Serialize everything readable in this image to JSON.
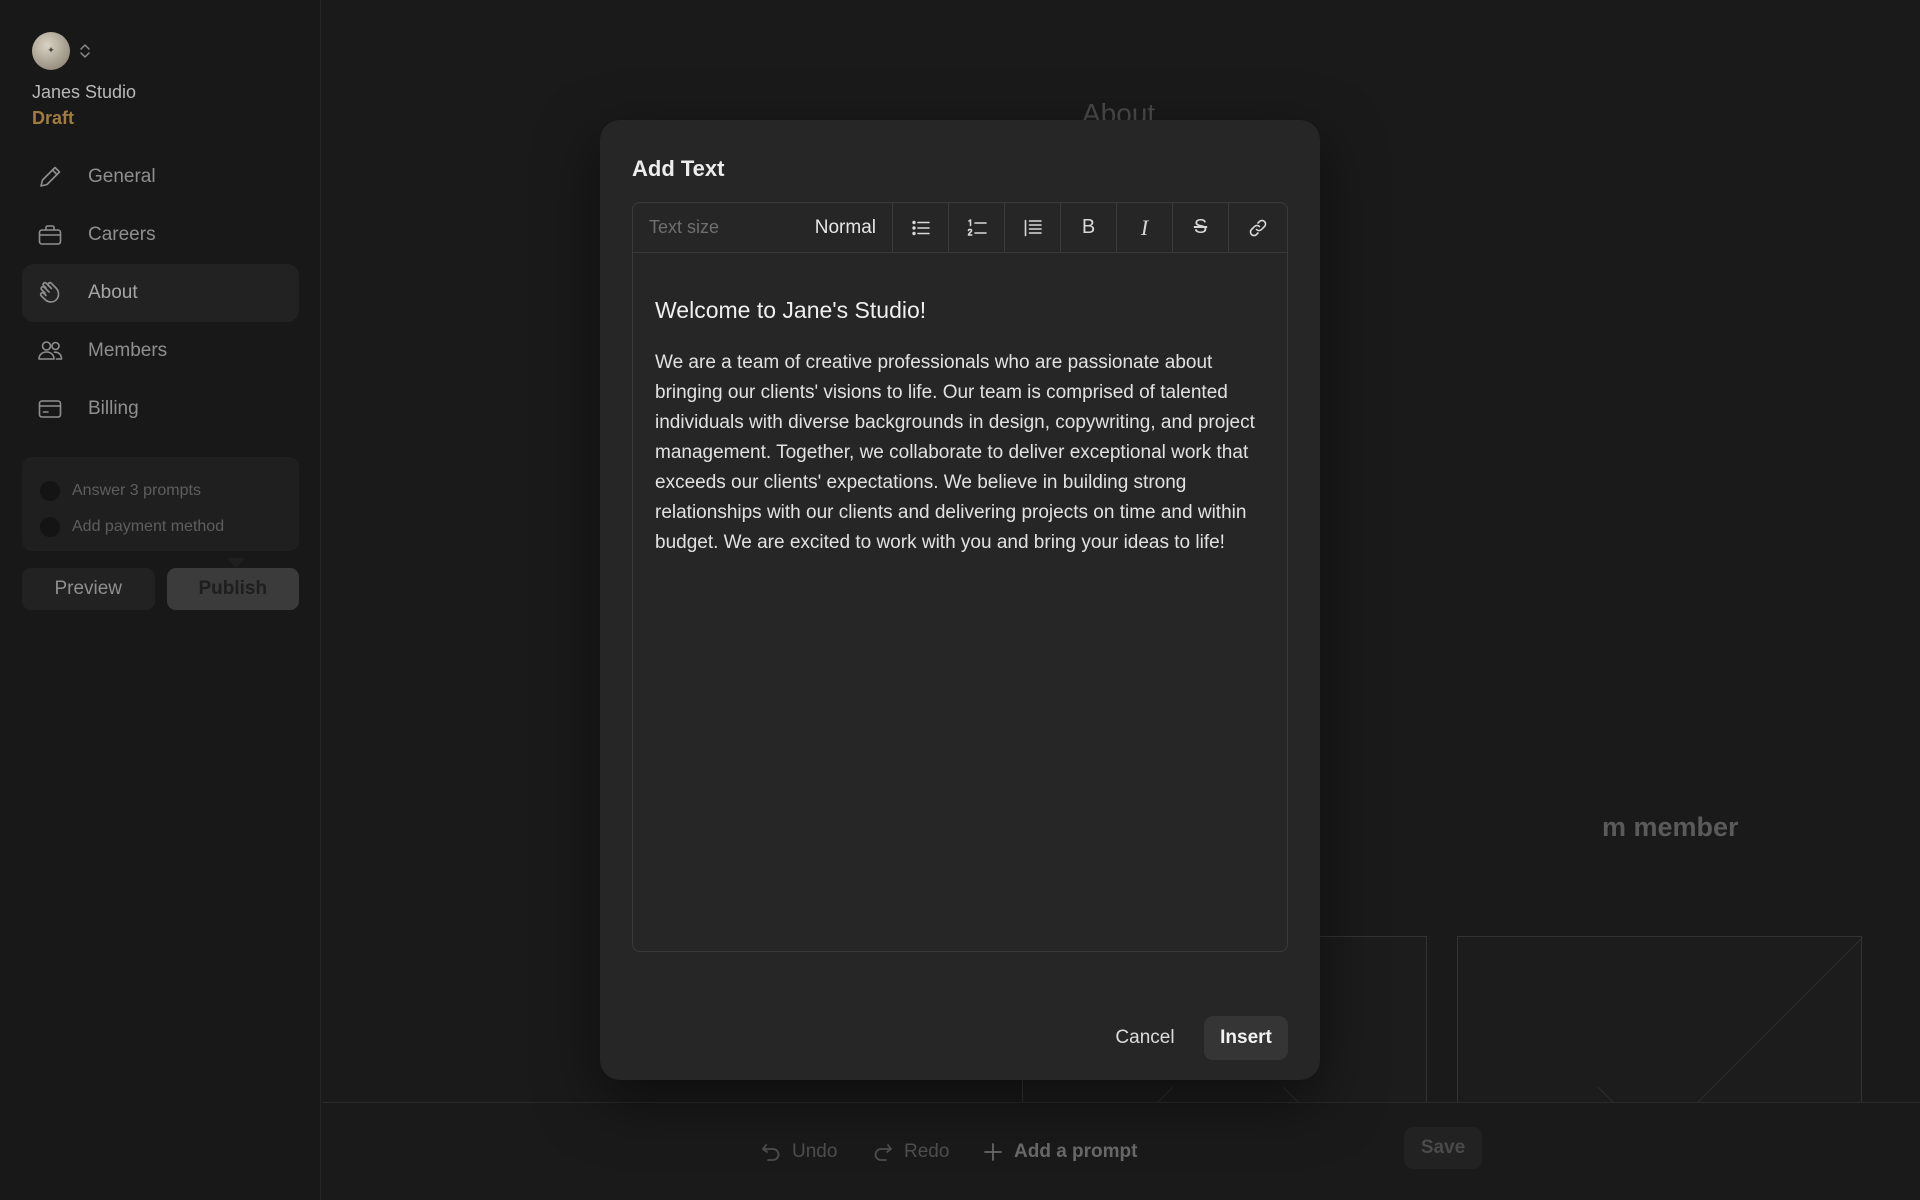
{
  "sidebar": {
    "workspace_name": "Janes Studio",
    "workspace_status": "Draft",
    "status_color": "#a27c3e",
    "nav": [
      {
        "label": "General",
        "icon": "pencil-icon"
      },
      {
        "label": "Careers",
        "icon": "briefcase-icon"
      },
      {
        "label": "About",
        "icon": "waving-hand-icon",
        "active": true
      },
      {
        "label": "Members",
        "icon": "users-icon"
      },
      {
        "label": "Billing",
        "icon": "credit-card-icon"
      }
    ],
    "checklist": [
      "Answer 3 prompts",
      "Add payment method"
    ],
    "preview_label": "Preview",
    "publish_label": "Publish"
  },
  "background": {
    "heading": "About",
    "member_heading": "m member"
  },
  "bottom_bar": {
    "undo_label": "Undo",
    "redo_label": "Redo",
    "add_prompt_label": "Add a prompt",
    "save_label": "Save"
  },
  "modal": {
    "title": "Add Text",
    "text_size_label": "Text size",
    "text_size_value": "Normal",
    "toolbar_buttons": [
      "bulleted-list-icon",
      "numbered-list-icon",
      "blockquote-icon",
      "bold-icon",
      "italic-icon",
      "strikethrough-icon",
      "link-icon"
    ],
    "bold_glyph": "B",
    "italic_glyph": "I",
    "strike_glyph": "S",
    "content_heading": "Welcome to Jane's Studio!",
    "content_body": "We are a team of creative professionals who are passionate about bringing our clients' visions to life. Our team is comprised of talented individuals with diverse backgrounds in design, copywriting, and project management. Together, we collaborate to deliver exceptional work that exceeds our clients' expectations. We believe in building strong relationships with our clients and delivering projects on time and within budget. We are excited to work with you and bring your ideas to life!",
    "cancel_label": "Cancel",
    "insert_label": "Insert"
  }
}
